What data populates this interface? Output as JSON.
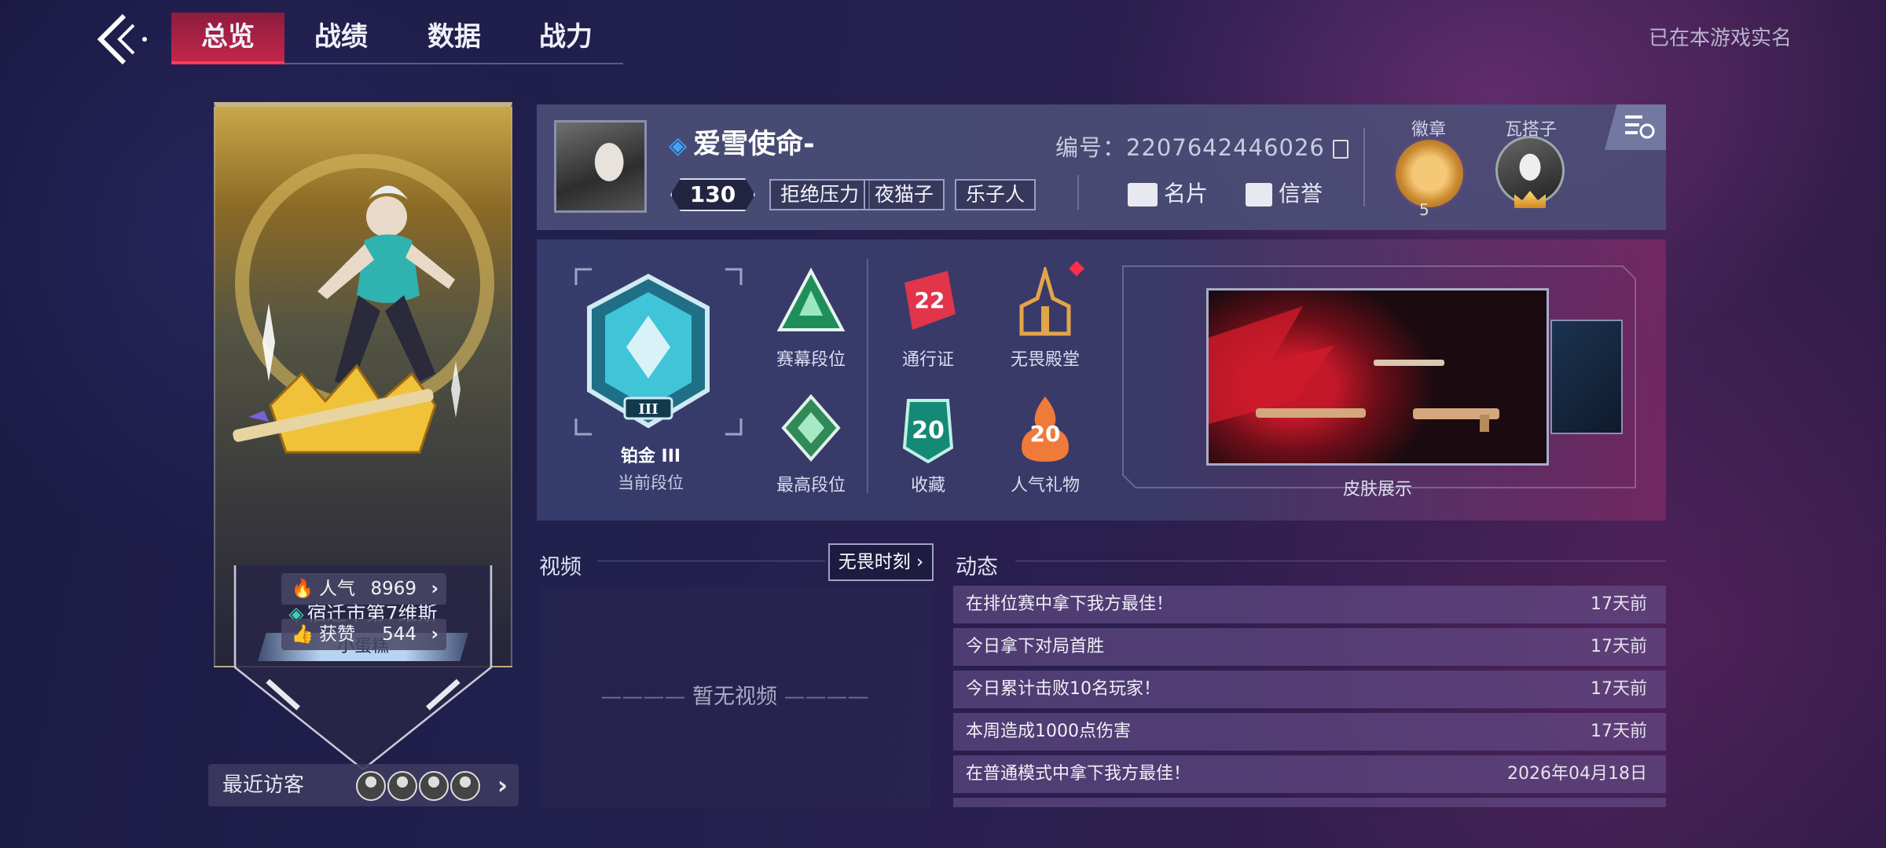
{
  "nav": {
    "tabs": [
      "总览",
      "战绩",
      "数据",
      "战力"
    ],
    "active_tab": 0,
    "realname_notice": "已在本游戏实名"
  },
  "player_card": {
    "location": "宿迁市第7维斯",
    "nickname_badge": "小蛋糕",
    "popularity_label": "人气",
    "popularity_value": "8969",
    "likes_label": "获赞",
    "likes_value": "544",
    "recent_visitors_label": "最近访客"
  },
  "profile": {
    "name": "爱雪使命-",
    "level": "130",
    "tags": [
      "拒绝压力",
      "夜猫子",
      "乐子人"
    ],
    "id_label": "编号：",
    "id_value": "2207642446026",
    "card_button": "名片",
    "credit_button": "信誉",
    "badge_label": "徽章",
    "badge_count": "5",
    "team_label": "瓦搭子"
  },
  "stats": {
    "current_rank": "铂金 III",
    "current_rank_label": "当前段位",
    "items": [
      {
        "label": "赛幕段位"
      },
      {
        "label": "通行证",
        "value": "22"
      },
      {
        "label": "无畏殿堂"
      },
      {
        "label": "最高段位"
      },
      {
        "label": "收藏",
        "value": "20"
      },
      {
        "label": "人气礼物",
        "value": "20"
      }
    ],
    "skin_label": "皮肤展示"
  },
  "video": {
    "title": "视频",
    "button": "无畏时刻",
    "empty": "暂无视频"
  },
  "feed": {
    "title": "动态",
    "rows": [
      {
        "text": "在排位赛中拿下我方最佳！",
        "time": "17天前"
      },
      {
        "text": "今日拿下对局首胜",
        "time": "17天前"
      },
      {
        "text": "今日累计击败10名玩家！",
        "time": "17天前"
      },
      {
        "text": "本周造成1000点伤害",
        "time": "17天前"
      },
      {
        "text": "在普通模式中拿下我方最佳！",
        "time": "2026年04月18日"
      }
    ]
  },
  "colors": {
    "accent_red": "#c1264a",
    "teal": "#3fd0b5",
    "gold": "#d7a53a"
  }
}
